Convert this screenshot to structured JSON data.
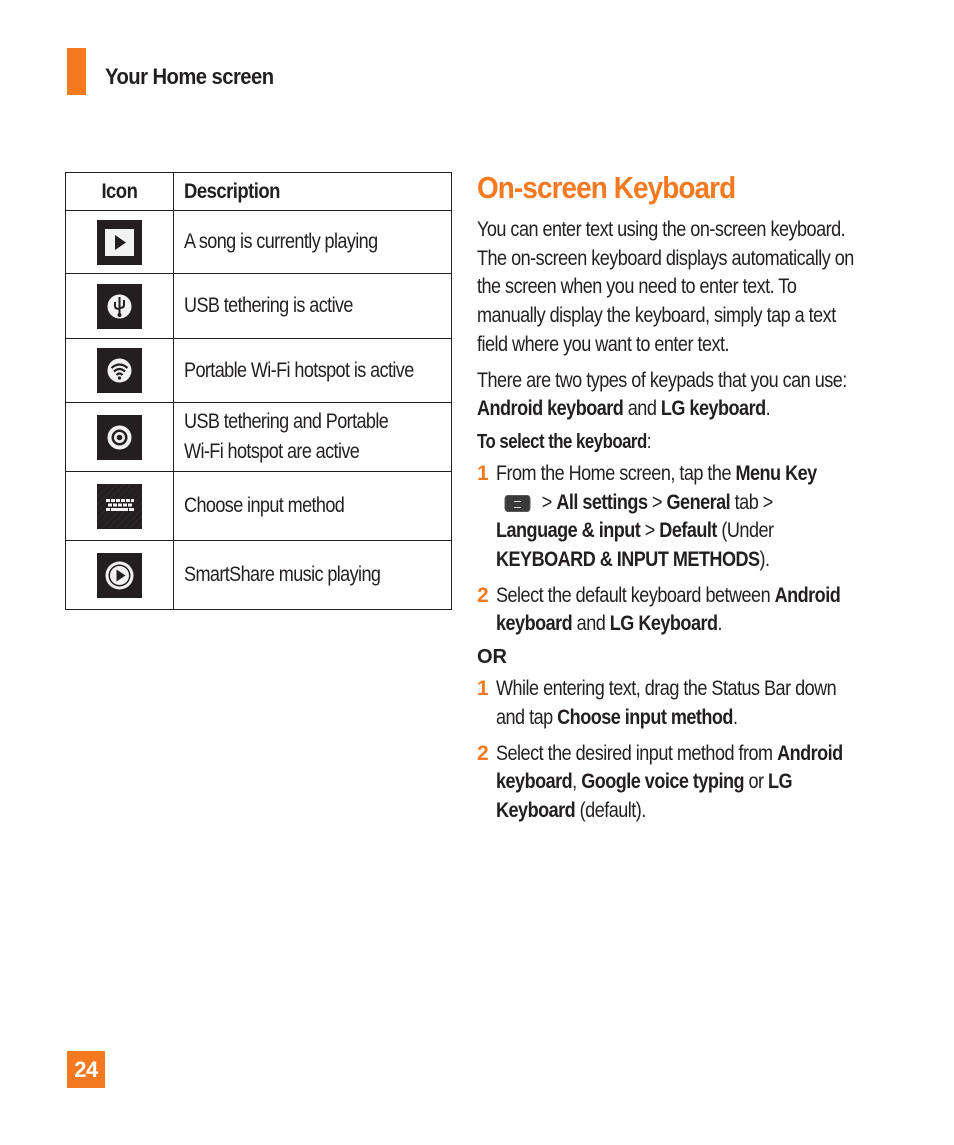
{
  "header": {
    "section_title": "Your Home screen",
    "accent_color": "#f47920"
  },
  "icon_table": {
    "headers": {
      "icon": "Icon",
      "description": "Description"
    },
    "rows": [
      {
        "icon": "music-playing-icon",
        "description": "A song is currently playing"
      },
      {
        "icon": "usb-tethering-icon",
        "description": "USB tethering is active"
      },
      {
        "icon": "wifi-hotspot-icon",
        "description": "Portable Wi-Fi hotspot is active"
      },
      {
        "icon": "usb-and-hotspot-icon",
        "description_lines": [
          "USB tethering and Portable",
          "Wi-Fi hotspot are active"
        ]
      },
      {
        "icon": "keyboard-icon",
        "description": "Choose input method"
      },
      {
        "icon": "smartshare-music-icon",
        "description": "SmartShare music playing"
      }
    ]
  },
  "keyboard_section": {
    "title": "On-screen Keyboard",
    "intro": "You can enter text using the on-screen keyboard. The on-screen keyboard displays automatically on the screen when you need to enter text. To manually display the keyboard, simply tap a text field where you want to enter text.",
    "types": {
      "prefix": "There are two types of keypads that you can use: ",
      "a": "Android keyboard",
      "and": " and ",
      "b": "LG keyboard",
      "end": "."
    },
    "select_heading": "To select the keyboard",
    "select_colon": ":",
    "steps_a": [
      {
        "num": "1",
        "t1": "From the Home screen, tap the ",
        "b1": "Menu Key",
        "t2": " > ",
        "b2": "All settings",
        "t3": " > ",
        "b3": "General",
        "t4": " tab > ",
        "b4": "Language & input",
        "t5": " > ",
        "b5": "Default",
        "t6": " (Under ",
        "b6": "KEYBOARD & INPUT METHODS",
        "t7": ")."
      },
      {
        "num": "2",
        "t1": "Select the default keyboard between ",
        "b1": "Android keyboard",
        "t2": " and ",
        "b2": "LG Keyboard",
        "t3": "."
      }
    ],
    "or_label": "OR",
    "steps_b": [
      {
        "num": "1",
        "t1": "While entering text, drag the Status Bar down and tap ",
        "b1": "Choose input method",
        "t2": "."
      },
      {
        "num": "2",
        "t1": "Select the desired input method from ",
        "b1": "Android keyboard",
        "t2": ", ",
        "b2": "Google voice typing",
        "t3": " or ",
        "b3": "LG Keyboard",
        "t4": " (default)."
      }
    ]
  },
  "footer": {
    "page_number": "24"
  }
}
